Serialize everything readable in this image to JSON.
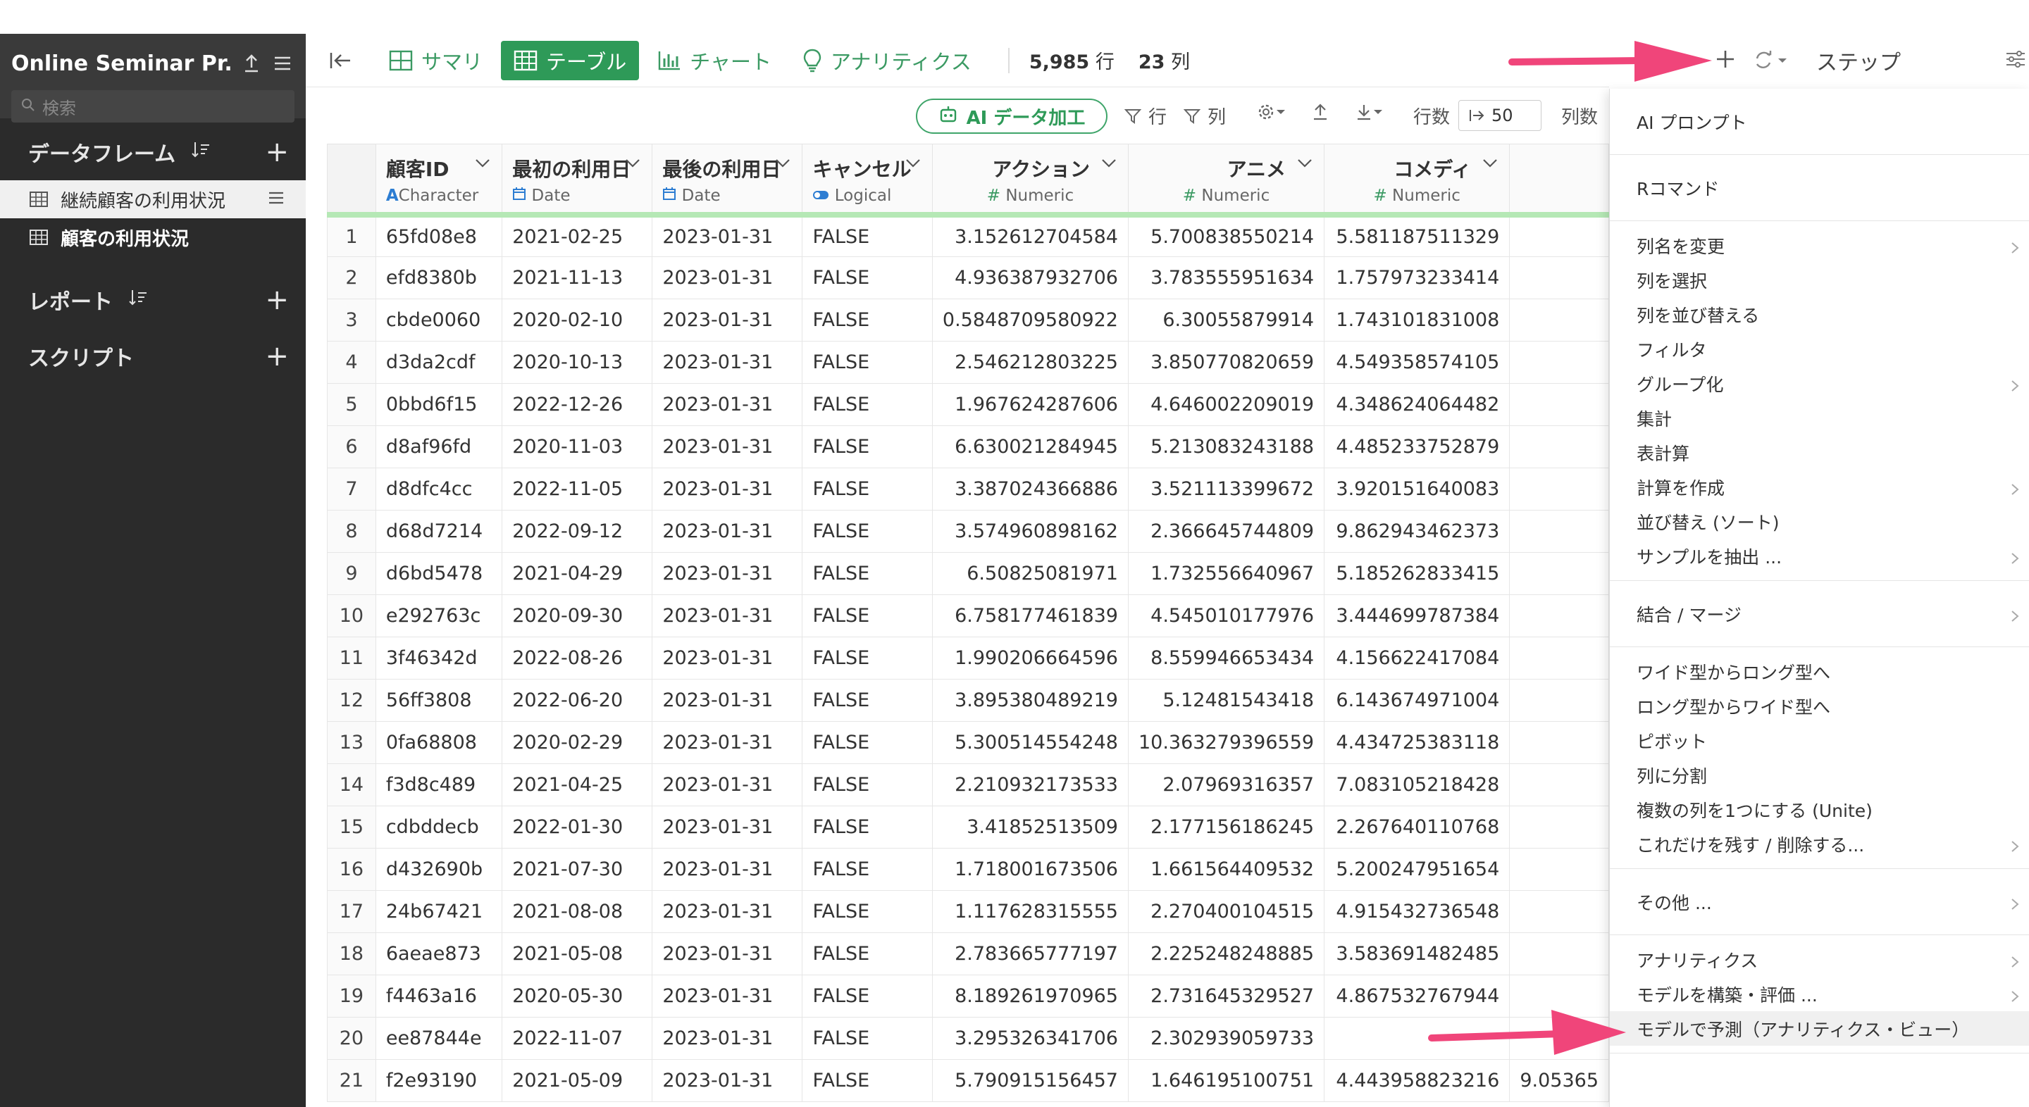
{
  "sidebar": {
    "project_title": "Online Seminar Pr...",
    "search_placeholder": "検索",
    "dataframes_label": "データフレーム",
    "dataframes": [
      {
        "name": "継続顧客の利用状況"
      },
      {
        "name": "顧客の利用状況"
      }
    ],
    "reports_label": "レポート",
    "scripts_label": "スクリプト"
  },
  "toolbar": {
    "tabs": [
      {
        "label": "サマリ"
      },
      {
        "label": "テーブル"
      },
      {
        "label": "チャート"
      },
      {
        "label": "アナリティクス"
      }
    ],
    "rows_count": "5,985",
    "rows_unit": "行",
    "cols_count": "23",
    "cols_unit": "列",
    "step_label": "ステップ"
  },
  "subbar": {
    "ai_button": "AI データ加工",
    "filter_rows": "行",
    "filter_cols": "列",
    "rows_label": "行数",
    "rows_value": "50",
    "cols_label": "列数"
  },
  "table": {
    "columns": [
      {
        "name": "顧客ID",
        "type": "Character"
      },
      {
        "name": "最初の利用日",
        "type": "Date"
      },
      {
        "name": "最後の利用日",
        "type": "Date"
      },
      {
        "name": "キャンセル",
        "type": "Logical"
      },
      {
        "name": "アクション",
        "type": "Numeric"
      },
      {
        "name": "アニメ",
        "type": "Numeric"
      },
      {
        "name": "コメディ",
        "type": "Numeric"
      }
    ],
    "rows": [
      [
        "1",
        "65fd08e8",
        "2021-02-25",
        "2023-01-31",
        "FALSE",
        "3.152612704584",
        "5.700838550214",
        "5.581187511329",
        ""
      ],
      [
        "2",
        "efd8380b",
        "2021-11-13",
        "2023-01-31",
        "FALSE",
        "4.936387932706",
        "3.783555951634",
        "1.757973233414",
        ""
      ],
      [
        "3",
        "cbde0060",
        "2020-02-10",
        "2023-01-31",
        "FALSE",
        "0.5848709580922",
        "6.30055879914",
        "1.743101831008",
        ""
      ],
      [
        "4",
        "d3da2cdf",
        "2020-10-13",
        "2023-01-31",
        "FALSE",
        "2.546212803225",
        "3.850770820659",
        "4.549358574105",
        ""
      ],
      [
        "5",
        "0bbd6f15",
        "2022-12-26",
        "2023-01-31",
        "FALSE",
        "1.967624287606",
        "4.646002209019",
        "4.348624064482",
        ""
      ],
      [
        "6",
        "d8af96fd",
        "2020-11-03",
        "2023-01-31",
        "FALSE",
        "6.630021284945",
        "5.213083243188",
        "4.485233752879",
        ""
      ],
      [
        "7",
        "d8dfc4cc",
        "2022-11-05",
        "2023-01-31",
        "FALSE",
        "3.387024366886",
        "3.521113399672",
        "3.920151640083",
        ""
      ],
      [
        "8",
        "d68d7214",
        "2022-09-12",
        "2023-01-31",
        "FALSE",
        "3.574960898162",
        "2.366645744809",
        "9.862943462373",
        ""
      ],
      [
        "9",
        "d6bd5478",
        "2021-04-29",
        "2023-01-31",
        "FALSE",
        "6.50825081971",
        "1.732556640967",
        "5.185262833415",
        ""
      ],
      [
        "10",
        "e292763c",
        "2020-09-30",
        "2023-01-31",
        "FALSE",
        "6.758177461839",
        "4.545010177976",
        "3.444699787384",
        ""
      ],
      [
        "11",
        "3f46342d",
        "2022-08-26",
        "2023-01-31",
        "FALSE",
        "1.990206664596",
        "8.559946653434",
        "4.156622417084",
        ""
      ],
      [
        "12",
        "56ff3808",
        "2022-06-20",
        "2023-01-31",
        "FALSE",
        "3.895380489219",
        "5.12481543418",
        "6.143674971004",
        ""
      ],
      [
        "13",
        "0fa68808",
        "2020-02-29",
        "2023-01-31",
        "FALSE",
        "5.300514554248",
        "10.363279396559",
        "4.434725383118",
        ""
      ],
      [
        "14",
        "f3d8c489",
        "2021-04-25",
        "2023-01-31",
        "FALSE",
        "2.210932173533",
        "2.07969316357",
        "7.083105218428",
        ""
      ],
      [
        "15",
        "cdbddecb",
        "2022-01-30",
        "2023-01-31",
        "FALSE",
        "3.41852513509",
        "2.177156186245",
        "2.267640110768",
        ""
      ],
      [
        "16",
        "d432690b",
        "2021-07-30",
        "2023-01-31",
        "FALSE",
        "1.718001673506",
        "1.661564409532",
        "5.200247951654",
        ""
      ],
      [
        "17",
        "24b67421",
        "2021-08-08",
        "2023-01-31",
        "FALSE",
        "1.117628315555",
        "2.270400104515",
        "4.915432736548",
        ""
      ],
      [
        "18",
        "6aeae873",
        "2021-05-08",
        "2023-01-31",
        "FALSE",
        "2.783665777197",
        "2.225248248885",
        "3.583691482485",
        ""
      ],
      [
        "19",
        "f4463a16",
        "2020-05-30",
        "2023-01-31",
        "FALSE",
        "8.189261970965",
        "2.731645329527",
        "4.867532767944",
        ""
      ],
      [
        "20",
        "ee87844e",
        "2022-11-07",
        "2023-01-31",
        "FALSE",
        "3.295326341706",
        "2.302939059733",
        "",
        ""
      ],
      [
        "21",
        "f2e93190",
        "2021-05-09",
        "2023-01-31",
        "FALSE",
        "5.790915156457",
        "1.646195100751",
        "4.443958823216",
        "9.05365"
      ]
    ]
  },
  "menu": {
    "sections": [
      [
        {
          "label": "AI プロンプト",
          "sub": false
        }
      ],
      [
        {
          "label": "Rコマンド",
          "sub": false
        }
      ],
      [
        {
          "label": "列名を変更",
          "sub": true
        },
        {
          "label": "列を選択",
          "sub": false
        },
        {
          "label": "列を並び替える",
          "sub": false
        },
        {
          "label": "フィルタ",
          "sub": false
        },
        {
          "label": "グループ化",
          "sub": true
        },
        {
          "label": "集計",
          "sub": false
        },
        {
          "label": "表計算",
          "sub": false
        },
        {
          "label": "計算を作成",
          "sub": true
        },
        {
          "label": "並び替え (ソート)",
          "sub": false
        },
        {
          "label": "サンプルを抽出 ...",
          "sub": true
        }
      ],
      [
        {
          "label": "結合 / マージ",
          "sub": true
        }
      ],
      [
        {
          "label": "ワイド型からロング型へ",
          "sub": false
        },
        {
          "label": "ロング型からワイド型へ",
          "sub": false
        },
        {
          "label": "ピボット",
          "sub": false
        },
        {
          "label": "列に分割",
          "sub": false
        },
        {
          "label": "複数の列を1つにする (Unite)",
          "sub": false
        },
        {
          "label": "これだけを残す / 削除する...",
          "sub": true
        }
      ],
      [
        {
          "label": "その他 ...",
          "sub": true
        }
      ],
      [
        {
          "label": "アナリティクス",
          "sub": true
        },
        {
          "label": "モデルを構築・評価 ...",
          "sub": true
        },
        {
          "label": "モデルで予測（アナリティクス・ビュー）",
          "sub": false
        }
      ]
    ]
  },
  "colors": {
    "accent": "#2e9a58",
    "sidebar_bg": "#2b2b2b",
    "arrow": "#f0457a",
    "header_underline": "#b5e8b5"
  }
}
